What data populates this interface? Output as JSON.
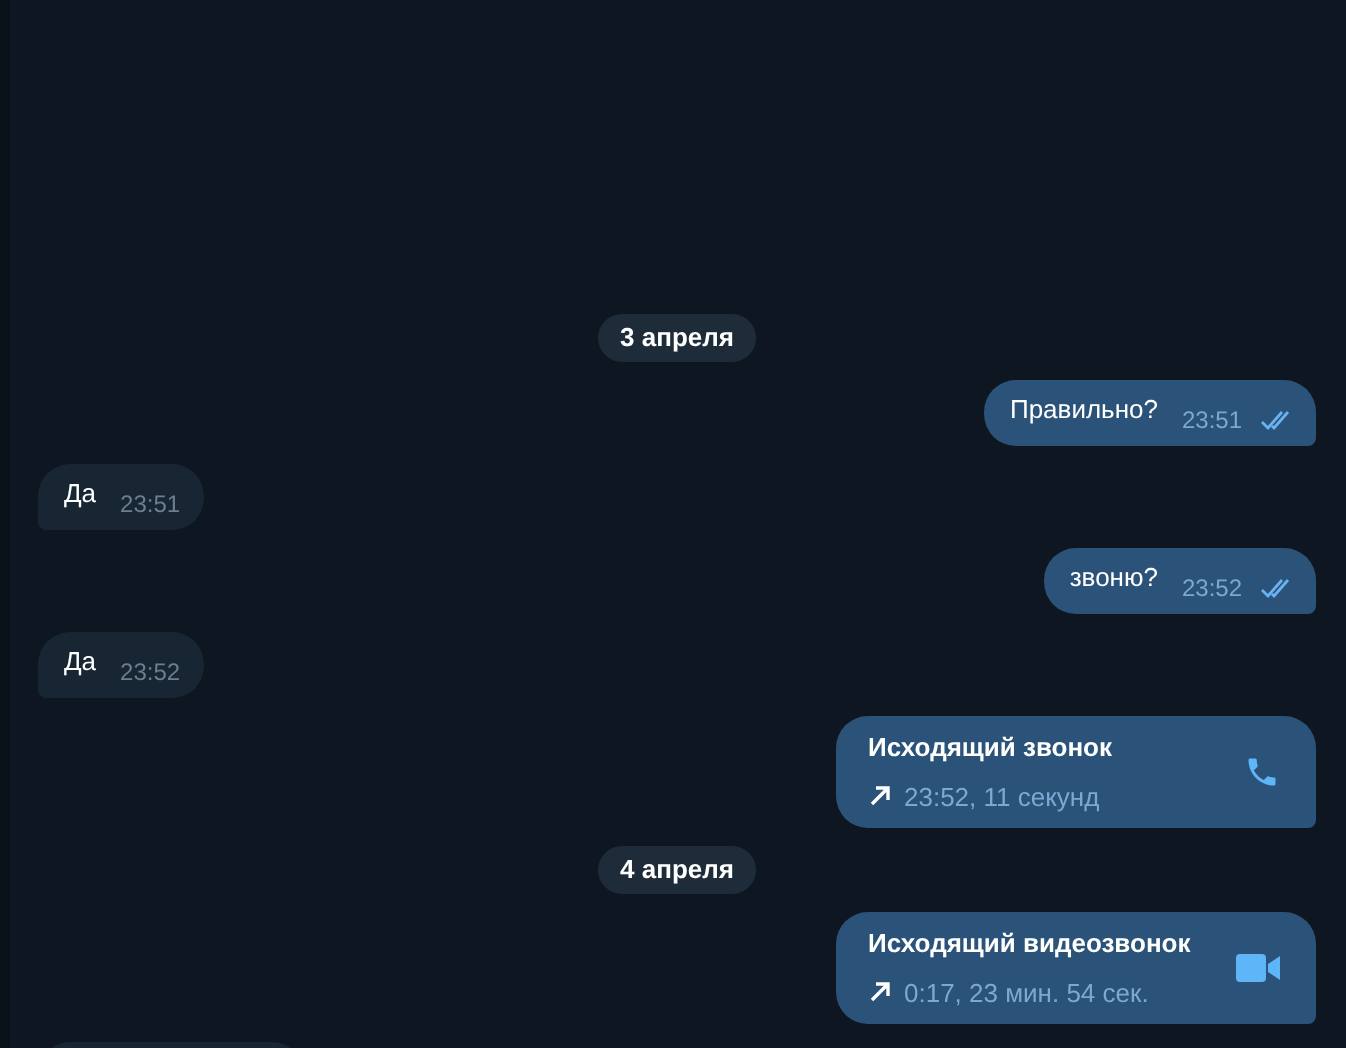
{
  "messages": [
    {
      "kind": "date",
      "text": "3 апреля"
    },
    {
      "kind": "out",
      "text": "Правильно?",
      "time": "23:51",
      "read": true
    },
    {
      "kind": "in",
      "text": "Да",
      "time": "23:51"
    },
    {
      "kind": "out",
      "text": "звоню?",
      "time": "23:52",
      "read": true
    },
    {
      "kind": "in",
      "text": "Да",
      "time": "23:52"
    },
    {
      "kind": "voice_call",
      "title": "Исходящий звонок",
      "detail": "23:52, 11 секунд"
    },
    {
      "kind": "date",
      "text": "4 апреля"
    },
    {
      "kind": "video_call",
      "title": "Исходящий видеозвонок",
      "detail": "0:17, 23 мин. 54 сек."
    },
    {
      "kind": "in"
    }
  ]
}
